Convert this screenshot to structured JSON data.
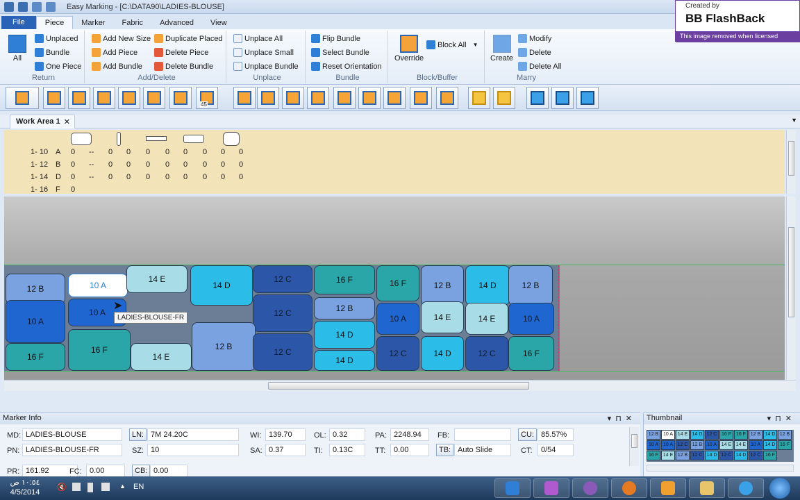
{
  "window": {
    "title": "Easy Marking - [C:\\DATA90\\LADIES-BLOUSE]"
  },
  "ribbon_tabs": [
    "File",
    "Piece",
    "Marker",
    "Fabric",
    "Advanced",
    "View"
  ],
  "ribbon": {
    "return": {
      "title": "Return",
      "all": "All",
      "unplaced": "Unplaced",
      "bundle": "Bundle",
      "one_piece": "One Piece"
    },
    "add_delete": {
      "title": "Add/Delete",
      "add_new_size": "Add New Size",
      "add_piece": "Add Piece",
      "add_bundle": "Add Bundle",
      "duplicate_placed": "Duplicate Placed",
      "delete_piece": "Delete Piece",
      "delete_bundle": "Delete Bundle"
    },
    "unplace": {
      "title": "Unplace",
      "unplace_all": "Unplace All",
      "unplace_small": "Unplace Small",
      "unplace_bundle": "Unplace Bundle"
    },
    "bundle": {
      "title": "Bundle",
      "flip_bundle": "Flip Bundle",
      "select_bundle": "Select Bundle",
      "reset_orientation": "Reset Orientation"
    },
    "block_buffer": {
      "title": "Block/Buffer",
      "override": "Override",
      "block_all": "Block All"
    },
    "marry": {
      "title": "Marry",
      "create": "Create",
      "modify": "Modify",
      "delete": "Delete",
      "delete_all": "Delete All"
    }
  },
  "toolbar_icons": [
    "align-horizontal-icon",
    "rotate-icon",
    "flip-icon",
    "split-icon",
    "move-left-icon",
    "ruler-icon",
    "stack-icon",
    "bracket-icon",
    "rotate-45-icon",
    "overlap-icon",
    "frame-icon",
    "cut-icon",
    "fold-icon",
    "center-icon",
    "diamond-icon",
    "corner-icon",
    "grid-icon",
    "paint-icon",
    "warning-icon",
    "info-icon",
    "view-1-icon",
    "view-2-icon",
    "view-3-icon"
  ],
  "rotate_label": "45",
  "work_area_tab": "Work Area 1",
  "piece_table": {
    "rows": [
      {
        "range": "1- 10",
        "code": "A",
        "values": [
          "0",
          "--",
          "0",
          "0",
          "0",
          "0",
          "0",
          "0",
          "0",
          "0"
        ]
      },
      {
        "range": "1- 12",
        "code": "B",
        "values": [
          "0",
          "--",
          "0",
          "0",
          "0",
          "0",
          "0",
          "0",
          "0",
          "0"
        ]
      },
      {
        "range": "1- 14",
        "code": "D",
        "values": [
          "0",
          "--",
          "0",
          "0",
          "0",
          "0",
          "0",
          "0",
          "0",
          "0"
        ]
      },
      {
        "range": "1- 16",
        "code": "F",
        "values": [
          "0",
          "",
          "",
          "",
          "",
          "",
          "",
          "",
          "",
          ""
        ]
      }
    ]
  },
  "marker_pieces": [
    {
      "label": "12 B",
      "color": "#7aa1e0"
    },
    {
      "label": "10 A",
      "color": "#ffffff"
    },
    {
      "label": "14 E",
      "color": "#a8dde8"
    },
    {
      "label": "14 D",
      "color": "#2bbce8"
    },
    {
      "label": "12 C",
      "color": "#2c57a8"
    },
    {
      "label": "16 F",
      "color": "#2aa5a8"
    },
    {
      "label": "16 F",
      "color": "#2aa5a8"
    },
    {
      "label": "12 B",
      "color": "#7aa1e0"
    },
    {
      "label": "14 D",
      "color": "#2bbce8"
    },
    {
      "label": "12 B",
      "color": "#7aa1e0"
    },
    {
      "label": "10 A",
      "color": "#1f66d0"
    },
    {
      "label": "10 A",
      "color": "#1f66d0"
    },
    {
      "label": "12 C",
      "color": "#2c57a8"
    },
    {
      "label": "12 B",
      "color": "#7aa1e0"
    },
    {
      "label": "10 A",
      "color": "#1f66d0"
    },
    {
      "label": "14 E",
      "color": "#a8dde8"
    },
    {
      "label": "14 E",
      "color": "#a8dde8"
    },
    {
      "label": "10 A",
      "color": "#1f66d0"
    },
    {
      "label": "14 D",
      "color": "#2bbce8"
    },
    {
      "label": "16 F",
      "color": "#2aa5a8"
    },
    {
      "label": "16 F",
      "color": "#2aa5a8"
    },
    {
      "label": "14 E",
      "color": "#a8dde8"
    },
    {
      "label": "12 B",
      "color": "#7aa1e0"
    },
    {
      "label": "12 C",
      "color": "#2c57a8"
    },
    {
      "label": "14 D",
      "color": "#2bbce8"
    },
    {
      "label": "12 C",
      "color": "#2c57a8"
    },
    {
      "label": "14 D",
      "color": "#2bbce8"
    },
    {
      "label": "12 C",
      "color": "#2c57a8"
    },
    {
      "label": "16 F",
      "color": "#2aa5a8"
    }
  ],
  "tooltip": "LADIES-BLOUSE-FR",
  "marker_info": {
    "title": "Marker Info",
    "md_label": "MD:",
    "md": "LADIES-BLOUSE",
    "pn_label": "PN:",
    "pn": "LADIES-BLOUSE-FR",
    "pr_label": "PR:",
    "pr": "161.92",
    "ln_label": "LN:",
    "ln": "7M 24.20C",
    "sz_label": "SZ:",
    "sz": "10",
    "fc_label": "FC:",
    "fc": "0.00",
    "cb_label": "CB:",
    "cb": "0.00",
    "wi_label": "WI:",
    "wi": "139.70",
    "sa_label": "SA:",
    "sa": "0.37",
    "ol_label": "OL:",
    "ol": "0.32",
    "ti_label": "TI:",
    "ti": "0.13C",
    "pa_label": "PA:",
    "pa": "2248.94",
    "tt_label": "TT:",
    "tt": "0.00",
    "fb_label": "FB:",
    "fb": "",
    "tb_label": "TB:",
    "tb": "Auto Slide",
    "cu_label": "CU:",
    "cu": "85.57%",
    "ct_label": "CT:",
    "ct": "0/54"
  },
  "thumbnail": {
    "title": "Thumbnail"
  },
  "taskbar": {
    "time": "١٠:٥٤ ص",
    "date": "4/5/2014",
    "lang": "EN"
  },
  "watermark": {
    "created_by": "Created by",
    "brand": "BB FlashBack",
    "notice": "This image removed when licensed"
  }
}
